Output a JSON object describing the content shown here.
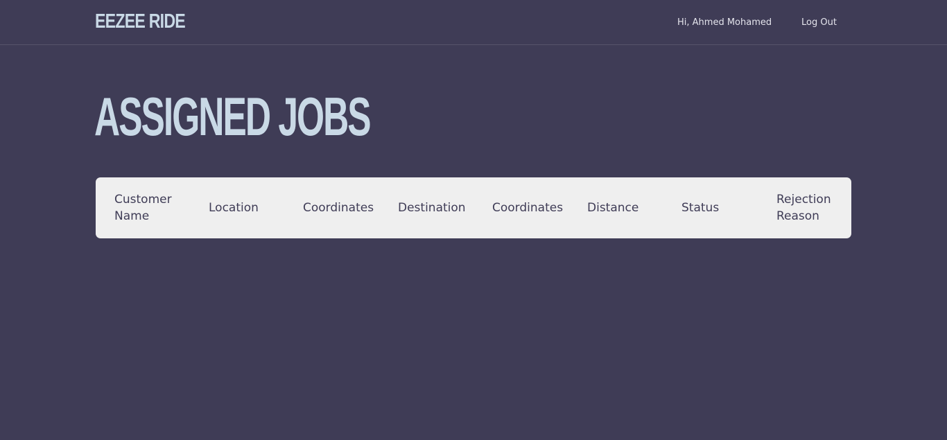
{
  "header": {
    "brand": "EEZEE RIDE",
    "greeting": "Hi, Ahmed Mohamed",
    "logout_label": "Log Out"
  },
  "main": {
    "title": "ASSIGNED JOBS",
    "table": {
      "columns": [
        "Customer Name",
        "Location",
        "Coordinates",
        "Destination",
        "Coordinates",
        "Distance",
        "Status",
        "Rejection Reason"
      ],
      "rows": []
    }
  },
  "colors": {
    "background": "#3f3c56",
    "accent": "#c9d9e6",
    "table_header_bg": "#efefef",
    "table_header_text": "#3f3c56"
  }
}
